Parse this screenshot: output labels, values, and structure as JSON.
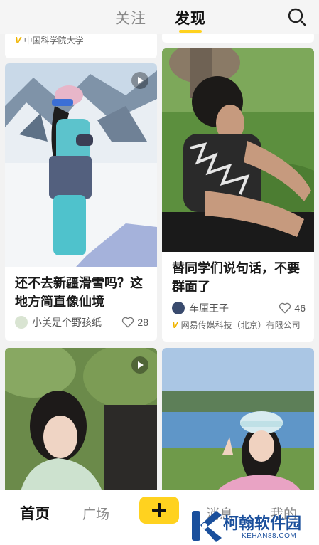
{
  "header": {
    "tabs": [
      {
        "label": "关注"
      },
      {
        "label": "发现"
      }
    ]
  },
  "feed": {
    "partial_top_left": {
      "verification": "中国科学院大学"
    },
    "cards": [
      {
        "title": "还不去新疆滑雪吗？这地方简直像仙境",
        "author": "小美是个野孩纸",
        "likes": "28",
        "video": true
      },
      {
        "title": "替同学们说句话，不要群面了",
        "author": "车厘王子",
        "likes": "46",
        "verification": "网易传媒科技（北京）有限公司"
      },
      {
        "video": true
      },
      {}
    ]
  },
  "bottom_nav": {
    "home": "首页",
    "square": "广场",
    "messages": "消息",
    "me": "我的"
  },
  "watermark": {
    "text": "柯翰软件园",
    "url": "KEHAN88.COM"
  },
  "colors": {
    "accent": "#ffd21f",
    "verified": "#f0b400",
    "watermark": "#1a4f9c"
  }
}
